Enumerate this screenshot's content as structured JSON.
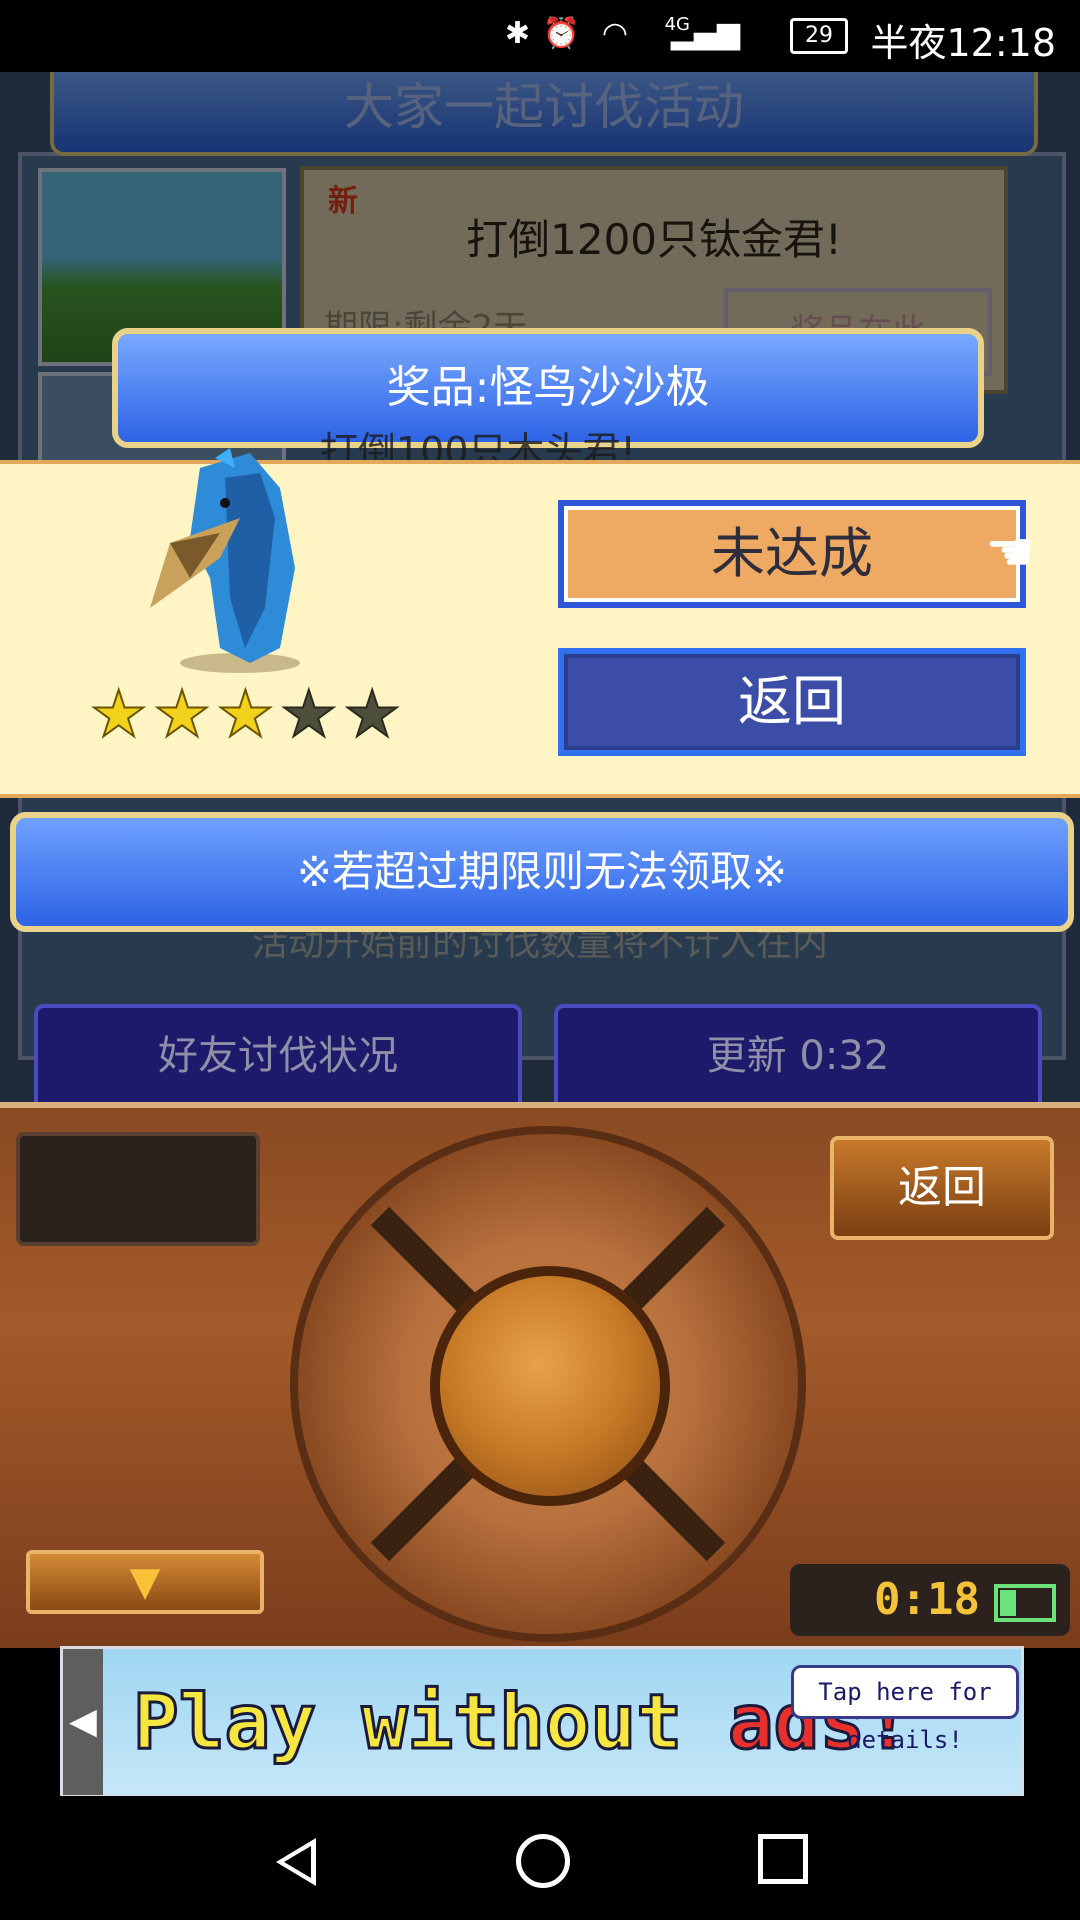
{
  "status_bar": {
    "bluetooth_icon": "bluetooth-icon",
    "alarm_icon": "alarm-icon",
    "wifi_icon": "wifi-icon",
    "network_label": "4G",
    "battery_level": "29",
    "time": "半夜12:18"
  },
  "game": {
    "page_title": "大家一起讨伐活动",
    "quest": {
      "new_badge": "新",
      "title": "打倒1200只钛金君!",
      "deadline_partial": "期限:剩余2天",
      "button_partial": "奖品在此",
      "second_partial": "打倒100只木头君!"
    },
    "prize_dialog": {
      "header": "奖品:怪鸟沙沙极",
      "stars_filled": 3,
      "stars_total": 5,
      "unreached_button": "未达成",
      "back_button": "返回"
    },
    "notice": "※若超过期限则无法领取※",
    "notice_under": "活动开始前的讨伐数量将不计入在内",
    "friend_status_button": "好友讨伐状况",
    "refresh_button": "更新 0:32"
  },
  "controller": {
    "back_button": "返回",
    "down_arrow": "▼",
    "timer": "0:18"
  },
  "ad": {
    "text_part1": "Play without ",
    "text_part2": "ads!",
    "bubble": "Tap here for details!"
  },
  "colors": {
    "blue_banner": "#2d63e5",
    "gold_border": "#e9d38a",
    "panel_cream": "#fff5c4",
    "unreached_orange": "#eea962"
  }
}
